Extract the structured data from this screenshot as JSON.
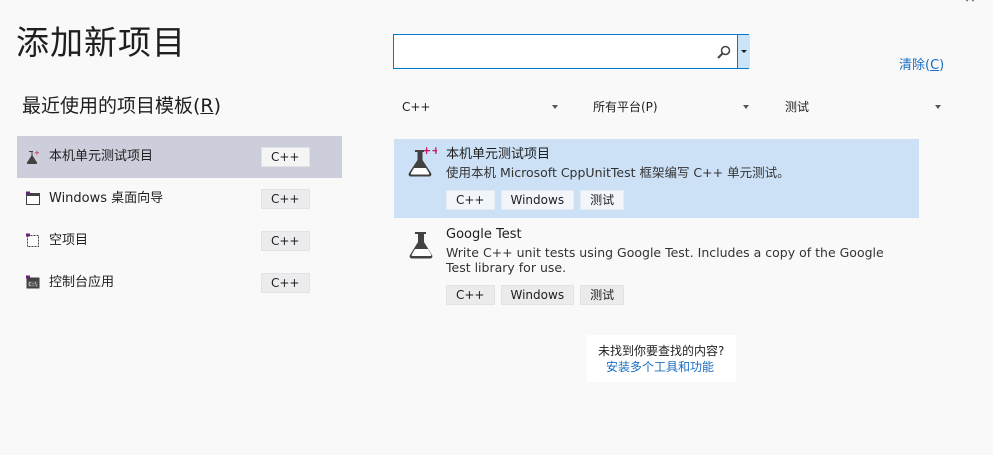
{
  "dialog": {
    "title": "添加新项目",
    "close_glyph": "×"
  },
  "recent": {
    "title_prefix": "最近使用的项目模板(",
    "title_mnemonic": "R",
    "title_suffix": ")",
    "items": [
      {
        "label": "本机单元测试项目",
        "tag": "C++",
        "icon": "flask-icon",
        "selected": true
      },
      {
        "label": "Windows 桌面向导",
        "tag": "C++",
        "icon": "window-icon",
        "selected": false
      },
      {
        "label": "空项目",
        "tag": "C++",
        "icon": "empty-project-icon",
        "selected": false
      },
      {
        "label": "控制台应用",
        "tag": "C++",
        "icon": "console-icon",
        "selected": false
      }
    ]
  },
  "search": {
    "value": "",
    "placeholder": ""
  },
  "clear": {
    "prefix": "清除(",
    "mnemonic": "C",
    "suffix": ")"
  },
  "filters": {
    "language": "C++",
    "platform": "所有平台(P)",
    "project_type": "测试"
  },
  "results": [
    {
      "title": "本机单元测试项目",
      "description": "使用本机 Microsoft CppUnitTest 框架编写 C++ 单元测试。",
      "tags": [
        "C++",
        "Windows",
        "测试"
      ],
      "icon": "flask-plus-icon",
      "selected": true
    },
    {
      "title": "Google Test",
      "description": "Write C++ unit tests using Google Test. Includes a copy of the Google Test library for use.",
      "tags": [
        "C++",
        "Windows",
        "测试"
      ],
      "icon": "flask-icon",
      "selected": false
    }
  ],
  "not_found": {
    "question": "未找到你要查找的内容?",
    "link": "安装多个工具和功能"
  },
  "colors": {
    "accent": "#007acc",
    "link": "#1a6dc2",
    "selected_recent": "#cccedb",
    "selected_result": "#cce1f5",
    "background": "#f9f9fa"
  }
}
